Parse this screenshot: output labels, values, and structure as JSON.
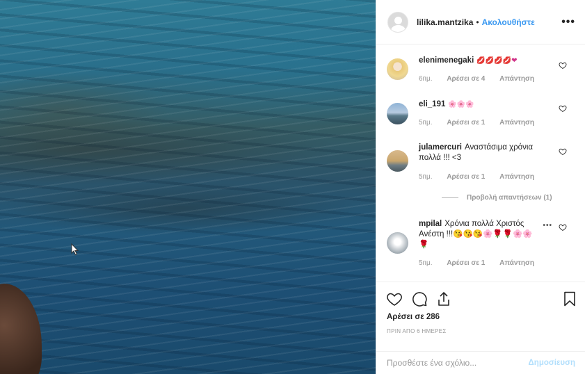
{
  "header": {
    "username": "lilika.mantzika",
    "separator": "•",
    "follow_label": "Ακολουθήστε",
    "more_icon": "more-horizontal-icon"
  },
  "comments": [
    {
      "username": "elenimenegaki",
      "text": "💋💋💋💋❤",
      "time": "6пμ.",
      "likes": "Αρέσει σε 4",
      "reply": "Απάντηση"
    },
    {
      "username": "eli_191",
      "text": "🌸🌸🌸",
      "time": "5пμ.",
      "likes": "Αρέσει σε 1",
      "reply": "Απάντηση"
    },
    {
      "username": "julamercuri",
      "text": "Αναστάσιμα χρόνια πολλά !!! <3",
      "time": "5пμ.",
      "likes": "Αρέσει σε 1",
      "reply": "Απάντηση",
      "view_replies": "Προβολή απαντήσεων (1)"
    },
    {
      "username": "mpilal",
      "text": "Χρόνια πολλά Χριστός Ανέστη !!!😘😘😘🌸🌹🌹🌸🌸🌹",
      "time": "5пμ.",
      "likes": "Αρέσει σε 1",
      "reply": "Απάντηση"
    }
  ],
  "actions": {
    "likes": "Αρέσει σε 286",
    "timestamp": "ΠΡΙΝ ΑΠΟ 6 ΗΜΕΡΕΣ"
  },
  "add_comment": {
    "placeholder": "Προσθέστε ένα σχόλιο...",
    "post_label": "Δημοσίευση"
  },
  "colors": {
    "link_blue": "#3897f0",
    "post_disabled": "#b2dffc",
    "muted": "#999999"
  }
}
